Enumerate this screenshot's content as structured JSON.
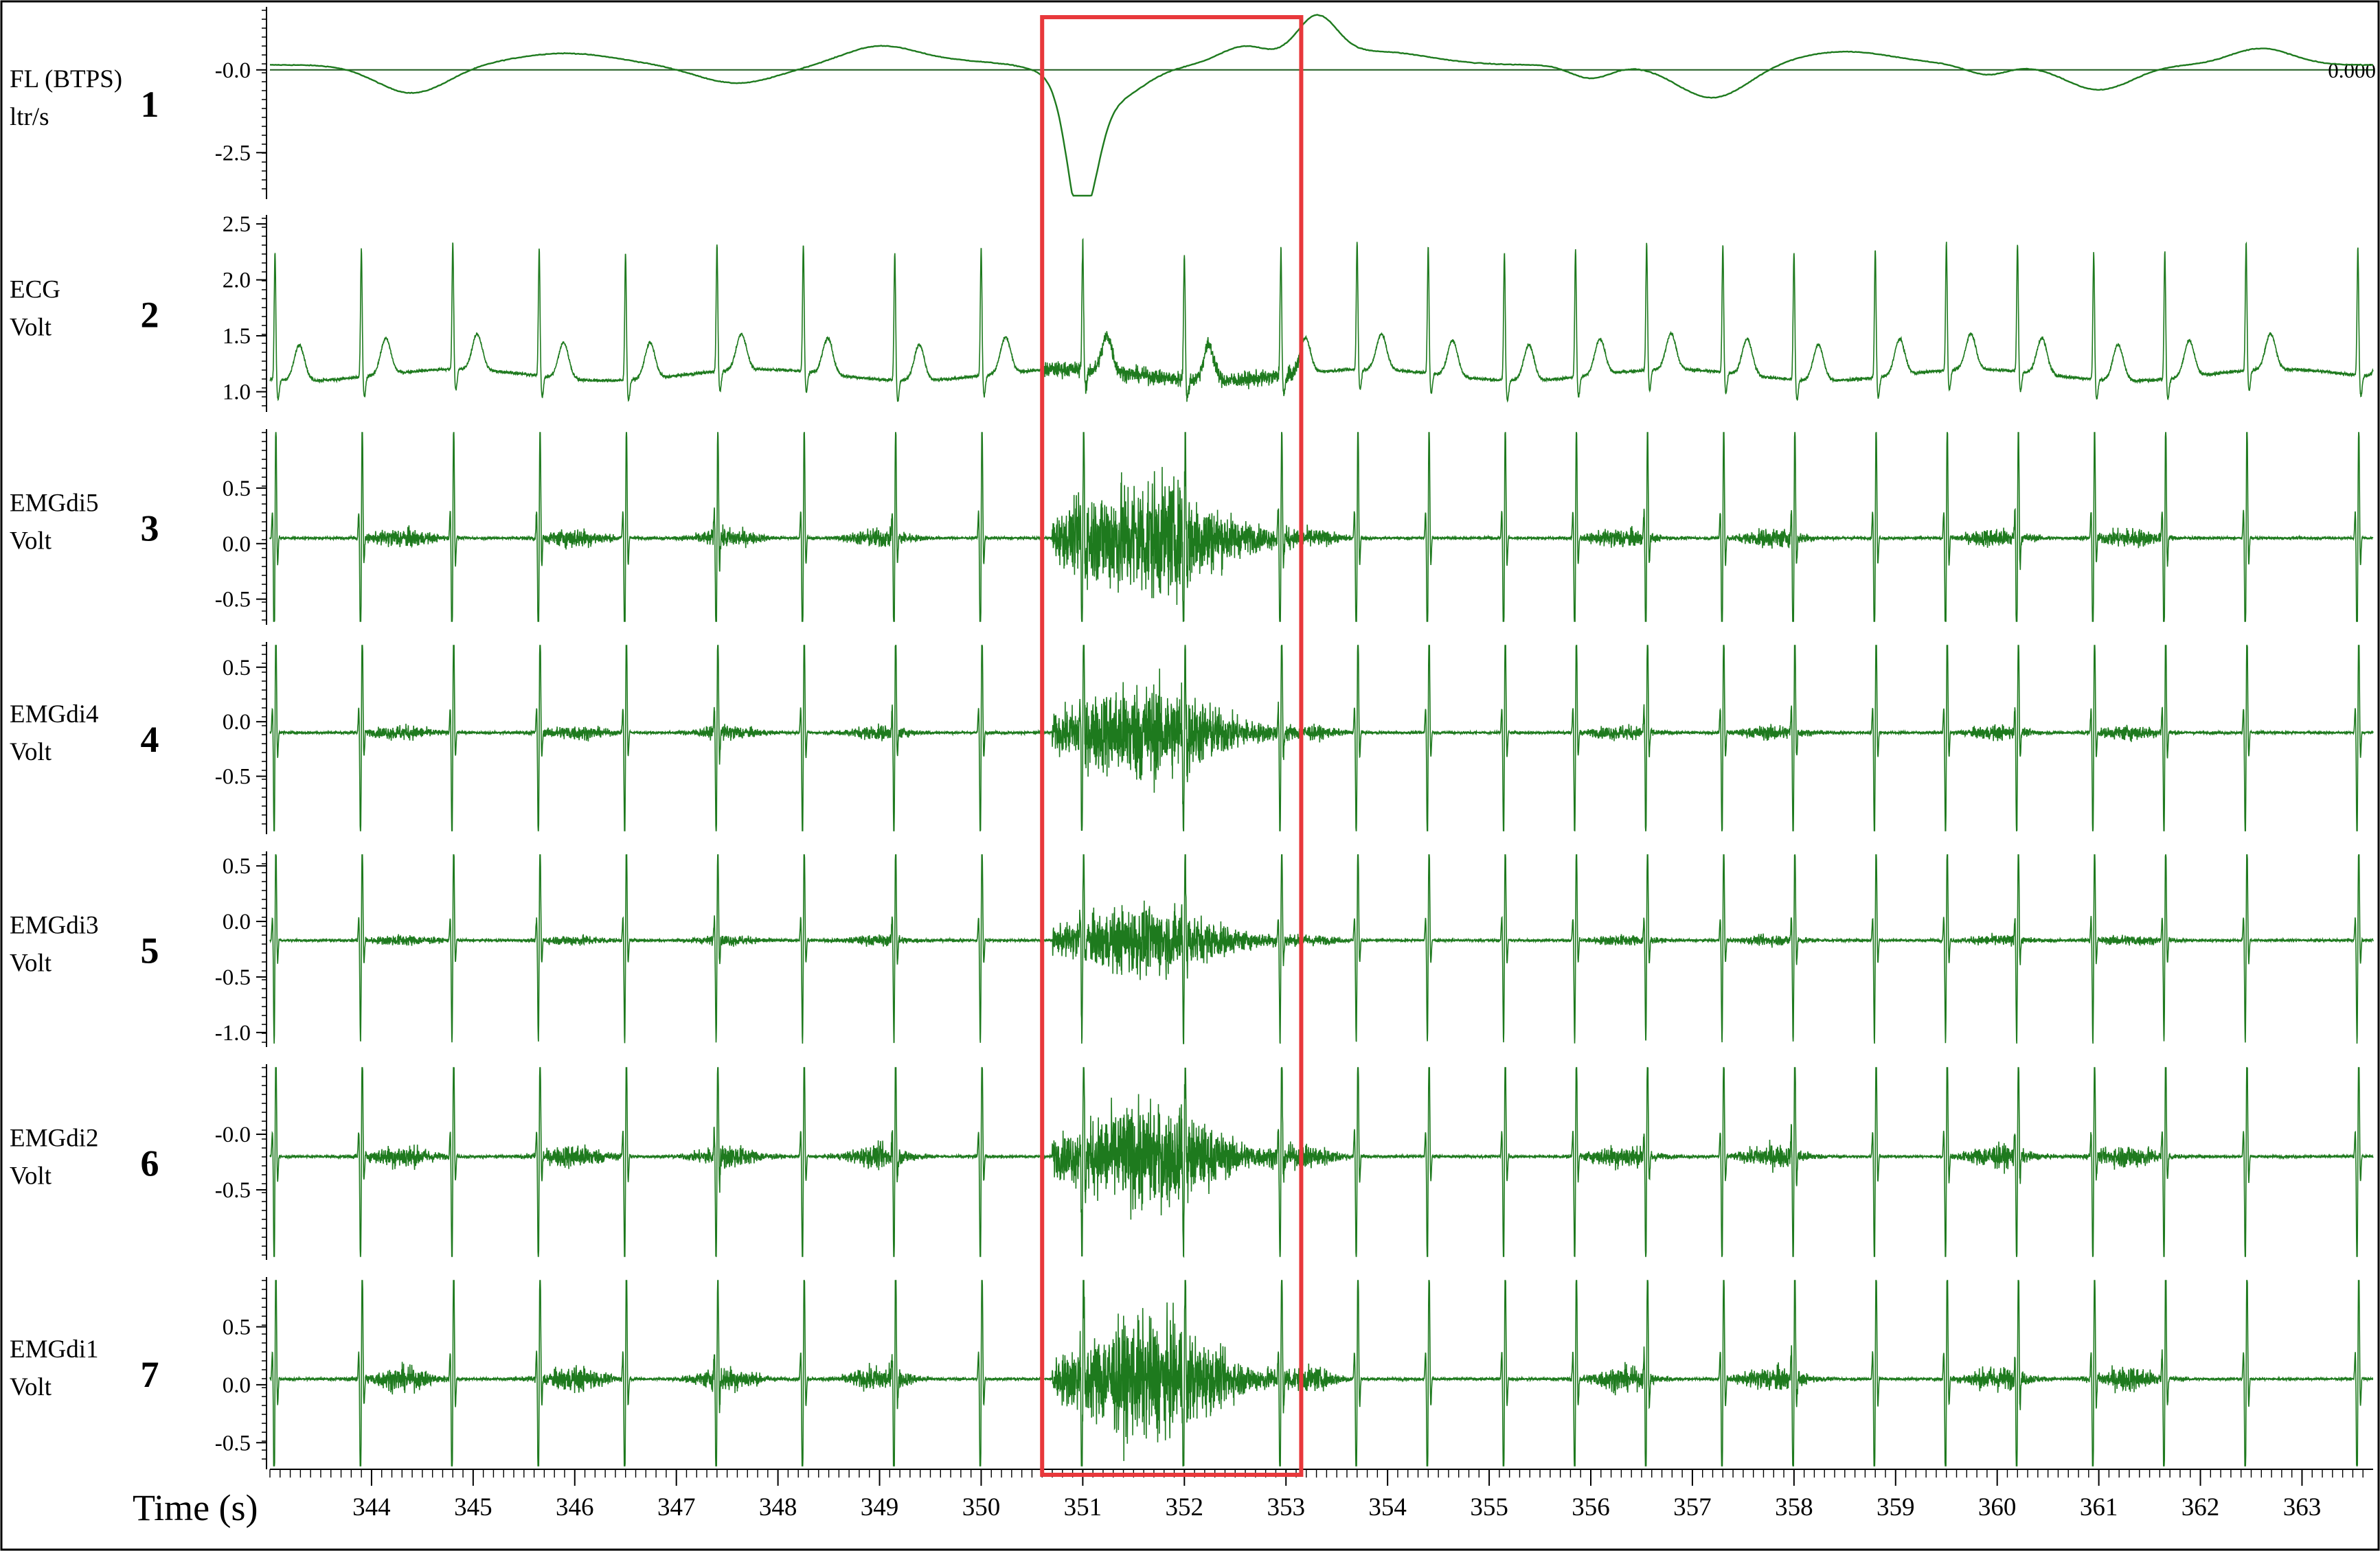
{
  "chart_data": {
    "type": "line",
    "xlabel": "Time (s)",
    "xlim": [
      343.0,
      363.7
    ],
    "xticks": [
      344,
      345,
      346,
      347,
      348,
      349,
      350,
      351,
      352,
      353,
      354,
      355,
      356,
      357,
      358,
      359,
      360,
      361,
      362,
      363
    ],
    "highlight": {
      "x": [
        350.6,
        353.15
      ],
      "color": "#e8383b"
    },
    "trace_color": "#1e7a1e",
    "breaths": [
      344.3,
      346.0,
      347.5,
      349.0,
      351.3,
      353.2,
      356.3,
      357.8,
      360.0,
      361.3
    ],
    "heartbeats": [
      343.05,
      343.9,
      344.8,
      345.65,
      346.5,
      347.4,
      348.25,
      349.15,
      350.0,
      351.0,
      352.0,
      352.95,
      353.7,
      354.4,
      355.15,
      355.85,
      356.55,
      357.3,
      358.0,
      358.8,
      359.5,
      360.2,
      360.95,
      361.65,
      362.45,
      363.55
    ],
    "series": [
      {
        "id": "fl",
        "number": "1",
        "name": "FL (BTPS)",
        "unit": "ltr/s",
        "ylim": [
          -3.8,
          1.8
        ],
        "yticks": [
          "-0.0",
          "-2.5"
        ],
        "ytick_values": [
          0.0,
          -2.5
        ],
        "ref_line": 0.0,
        "ref_label": "0.000"
      },
      {
        "id": "ecg",
        "number": "2",
        "name": "ECG",
        "unit": "Volt",
        "ylim": [
          0.85,
          2.55
        ],
        "yticks": [
          "2.5",
          "2.0",
          "1.5",
          "1.0"
        ],
        "ytick_values": [
          2.5,
          2.0,
          1.5,
          1.0
        ],
        "baseline": 1.15
      },
      {
        "id": "emgdi5",
        "number": "3",
        "name": "EMGdi5",
        "unit": "Volt",
        "ylim": [
          -0.7,
          1.0
        ],
        "yticks": [
          "0.5",
          "0.0",
          "-0.5"
        ],
        "ytick_values": [
          0.5,
          0.0,
          -0.5
        ],
        "baseline": 0.05,
        "burst_amp": 0.08,
        "main_amp": 0.55
      },
      {
        "id": "emgdi4",
        "number": "4",
        "name": "EMGdi4",
        "unit": "Volt",
        "ylim": [
          -1.0,
          0.7
        ],
        "yticks": [
          "0.5",
          "0.0",
          "-0.5"
        ],
        "ytick_values": [
          0.5,
          0.0,
          -0.5
        ],
        "baseline": -0.1,
        "burst_amp": 0.06,
        "main_amp": 0.45
      },
      {
        "id": "emgdi3",
        "number": "5",
        "name": "EMGdi3",
        "unit": "Volt",
        "ylim": [
          -1.1,
          0.6
        ],
        "yticks": [
          "0.5",
          "0.0",
          "-0.5",
          "-1.0"
        ],
        "ytick_values": [
          0.5,
          0.0,
          -0.5,
          -1.0
        ],
        "baseline": -0.17,
        "burst_amp": 0.04,
        "main_amp": 0.3
      },
      {
        "id": "emgdi2",
        "number": "6",
        "name": "EMGdi2",
        "unit": "Volt",
        "ylim": [
          -1.1,
          0.6
        ],
        "yticks": [
          "-0.0",
          "-0.5"
        ],
        "ytick_values": [
          0.0,
          -0.5
        ],
        "baseline": -0.2,
        "burst_amp": 0.1,
        "main_amp": 0.45
      },
      {
        "id": "emgdi1",
        "number": "7",
        "name": "EMGdi1",
        "unit": "Volt",
        "ylim": [
          -0.7,
          0.9
        ],
        "yticks": [
          "0.5",
          "0.0",
          "-0.5"
        ],
        "ytick_values": [
          0.5,
          0.0,
          -0.5
        ],
        "baseline": 0.05,
        "burst_amp": 0.1,
        "main_amp": 0.5
      }
    ]
  }
}
